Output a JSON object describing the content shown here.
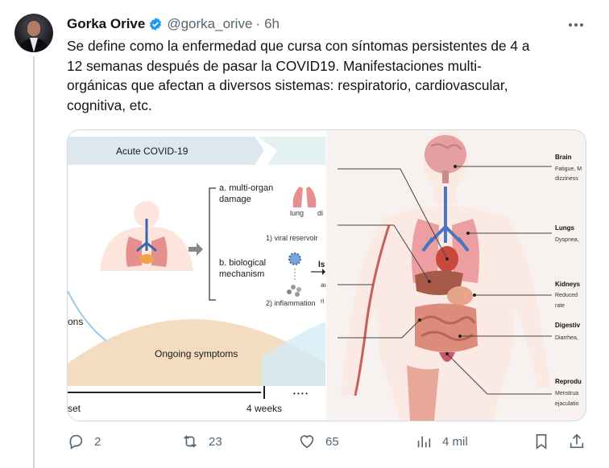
{
  "tweet": {
    "author_name": "Gorka Orive",
    "handle": "@gorka_orive",
    "separator": "·",
    "time": "6h",
    "text_lines": [
      "Se define como la enfermedad que cursa con síntomas persistentes de 4 a",
      "12 semanas después de pasar la COVID19. Manifestaciones multi-",
      "orgánicas que afectan a diversos sistemas: respiratorio, cardiovascular,",
      "cognitiva, etc."
    ]
  },
  "media_left": {
    "banner": "Acute COVID-19",
    "a_title": "a. multi-organ",
    "a_title2": "damage",
    "lung": "lung",
    "di": "di",
    "viral": "1) viral reservoir",
    "b_title": "b. biological",
    "b_title2": "mechanism",
    "inflammation": "2) inflammation",
    "ons": "ons",
    "ongoing": "Ongoing symptoms",
    "set": "set",
    "four_weeks": "4 weeks",
    "dots": "• • • •",
    "ls": "ls",
    "an": "an",
    "ri": "ri"
  },
  "media_right": {
    "brain": "Brain",
    "brain_desc1": "Fatigue, M",
    "brain_desc2": "dizziness",
    "lungs": "Lungs",
    "lungs_desc": "Dyspnea,",
    "kidneys": "Kidneys",
    "kidneys_desc1": "Reduced",
    "kidneys_desc2": "rate",
    "digestive": "Digestiv",
    "digestive_desc": "Diarrhea,",
    "repro": "Reprodu",
    "repro_desc1": "Menstrua",
    "repro_desc2": "ejaculatio"
  },
  "actions": {
    "replies": "2",
    "retweets": "23",
    "likes": "65",
    "views": "4 mil"
  },
  "colors": {
    "verified": "#1d9bf0",
    "muted": "#536471",
    "banner": "#dde7ee",
    "curve_orange": "#f0d4b0",
    "curve_blue": "#9ec9e6"
  }
}
